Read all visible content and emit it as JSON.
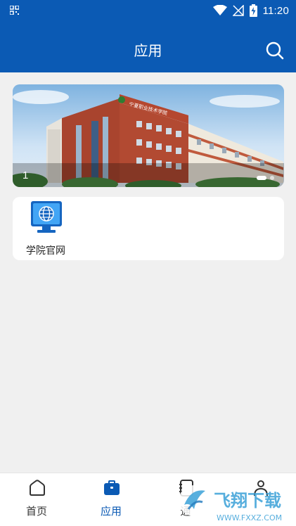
{
  "status_bar": {
    "time": "11:20",
    "icons": [
      "qr-grid-icon",
      "wifi-icon",
      "no-signal-icon",
      "battery-charging-icon"
    ]
  },
  "header": {
    "title": "应用",
    "search_icon": "search-icon"
  },
  "banner": {
    "index_label": "1",
    "slide_count": 2,
    "active_slide": 1,
    "image": "campus-building-photo"
  },
  "apps": [
    {
      "label": "学院官网",
      "icon": "website-monitor-icon"
    }
  ],
  "bottom_nav": [
    {
      "label": "首页",
      "icon": "home-icon",
      "active": false
    },
    {
      "label": "应用",
      "icon": "briefcase-icon",
      "active": true
    },
    {
      "label": "通",
      "icon": "notebook-icon",
      "active": false
    },
    {
      "label": "",
      "icon": "person-icon",
      "active": false
    }
  ],
  "watermark": {
    "text": "飞翔下载",
    "url": "WWW.FXXZ.COM"
  },
  "colors": {
    "primary": "#0b5ab4",
    "background": "#f0f0f0",
    "card": "#ffffff"
  }
}
